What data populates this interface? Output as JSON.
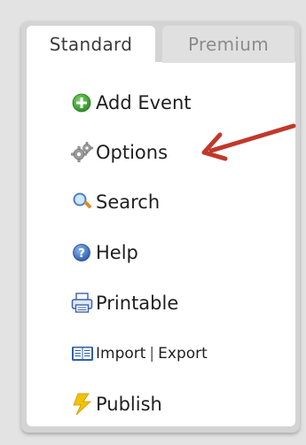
{
  "tabs": {
    "standard": "Standard",
    "premium": "Premium"
  },
  "menu": {
    "add_event": "Add Event",
    "options": "Options",
    "search": "Search",
    "help": "Help",
    "printable": "Printable",
    "import": "Import",
    "export": "Export",
    "publish": "Publish"
  },
  "icons": {
    "add_event": "plus-circle-icon",
    "options": "gear-icon",
    "search": "magnifier-icon",
    "help": "question-circle-icon",
    "printable": "printer-icon",
    "import_export": "book-icon",
    "publish": "lightning-icon"
  },
  "colors": {
    "arrow": "#c0392b",
    "active_tab": "#ffffff",
    "inactive_tab": "#e0e0e0",
    "panel": "#d4d4d4",
    "add_icon": "#3fa535",
    "publish_icon": "#f2c200"
  }
}
